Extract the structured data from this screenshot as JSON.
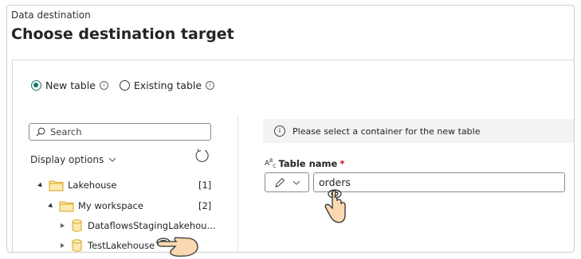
{
  "dialog": {
    "subtitle": "Data destination",
    "title": "Choose destination target"
  },
  "target_mode": {
    "options": [
      {
        "label": "New table",
        "selected": true
      },
      {
        "label": "Existing table",
        "selected": false
      }
    ]
  },
  "navigator": {
    "search_placeholder": "Search",
    "display_options_label": "Display options",
    "tree": [
      {
        "label": "Lakehouse",
        "count": "[1]",
        "icon": "folder-icon",
        "expanded": true
      },
      {
        "label": "My workspace",
        "count": "[2]",
        "icon": "folder-icon",
        "expanded": true
      },
      {
        "label": "DataflowsStagingLakehou...",
        "icon": "database-icon",
        "expanded": false
      },
      {
        "label": "TestLakehouse",
        "icon": "database-icon",
        "expanded": false
      }
    ]
  },
  "info_message": "Please select a container for the new table",
  "table_name": {
    "label": "Table name",
    "required_mark": "*",
    "value": "orders"
  },
  "colors": {
    "accent": "#117865",
    "folder_fill": "#fde9b0",
    "folder_stroke": "#d9a520",
    "cursor_fill": "#fad9b0"
  }
}
